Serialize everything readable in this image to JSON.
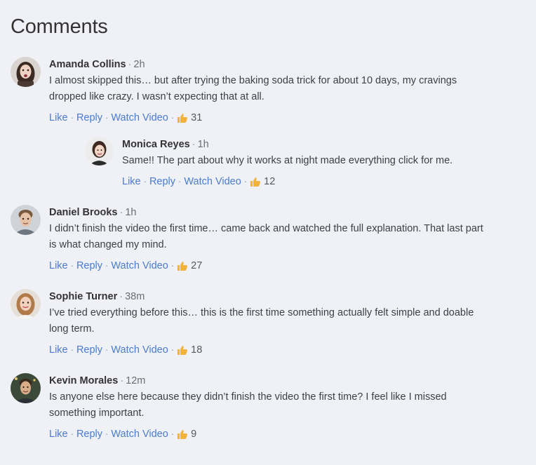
{
  "page_title": "Comments",
  "actions": {
    "like": "Like",
    "reply": "Reply",
    "watch": "Watch Video"
  },
  "colors": {
    "background": "#f0f1f6",
    "link": "#4a7bd0",
    "thumb": "#f2b33d"
  },
  "comments": [
    {
      "name": "Amanda Collins",
      "time": "2h",
      "text_lines": [
        "I almost skipped this… but after trying the baking soda trick for about 10 days, my cravings",
        "dropped like crazy. I wasn’t expecting that at all."
      ],
      "likes": "31",
      "reply": {
        "name": "Monica Reyes",
        "time": "1h",
        "text_lines": [
          "Same!! The part about why it works at night made everything click for me."
        ],
        "likes": "12"
      }
    },
    {
      "name": "Daniel Brooks",
      "time": "1h",
      "text_lines": [
        "I didn’t finish the video the first time… came back and watched the full explanation. That last part",
        "is what changed my mind."
      ],
      "likes": "27"
    },
    {
      "name": "Sophie Turner",
      "time": "38m",
      "text_lines": [
        "I’ve tried everything before this… this is the first time something actually felt simple and doable",
        "long term."
      ],
      "likes": "18"
    },
    {
      "name": "Kevin Morales",
      "time": "12m",
      "text_lines": [
        "Is anyone else here because they didn’t finish the video the first time? I feel like I missed",
        "something important."
      ],
      "likes": "9"
    }
  ]
}
